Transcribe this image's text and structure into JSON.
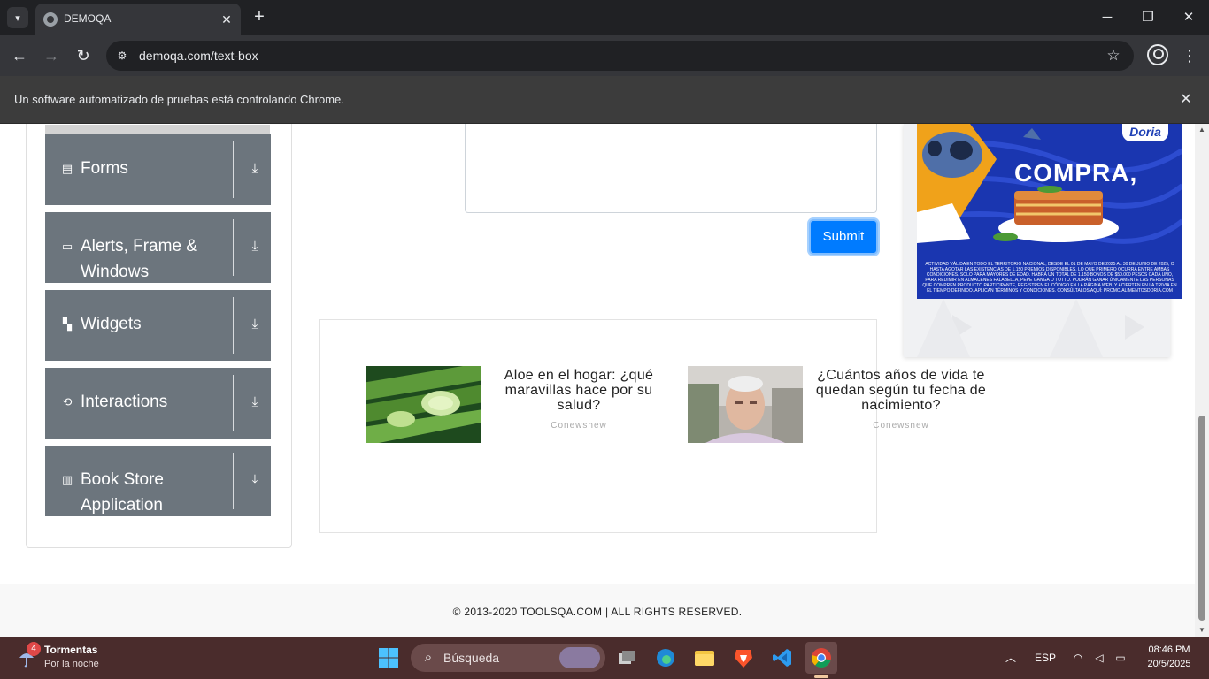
{
  "browser": {
    "tab_title": "DEMOQA",
    "url": "demoqa.com/text-box",
    "infobar_text": "Un software automatizado de pruebas está controlando Chrome."
  },
  "sidebar": {
    "groups": [
      {
        "label": "Forms",
        "icon": "document-icon"
      },
      {
        "label": "Alerts, Frame & Windows",
        "icon": "window-icon"
      },
      {
        "label": "Widgets",
        "icon": "widgets-icon"
      },
      {
        "label": "Interactions",
        "icon": "interactions-icon"
      },
      {
        "label": "Book Store Application",
        "icon": "books-icon"
      }
    ]
  },
  "form": {
    "submit_label": "Submit"
  },
  "ads": {
    "stories": [
      {
        "title": "Aloe en el hogar: ¿qué maravillas hace por su salud?",
        "source": "Conewsnew"
      },
      {
        "title": "¿Cuántos años de vida te quedan según tu fecha de nacimiento?",
        "source": "Conewsnew"
      }
    ],
    "banner": {
      "brand": "Doria",
      "headline": "COMPRA,",
      "legal": "ACTIVIDAD VÁLIDA EN TODO EL TERRITORIO NACIONAL, DESDE EL 01 DE MAYO DE 2025 AL 30 DE JUNIO DE 2025, O HASTA AGOTAR LAS EXISTENCIAS DE 1.150 PREMIOS DISPONIBLES, LO QUE PRIMERO OCURRA ENTRE AMBAS CONDICIONES. SOLO PARA MAYORES DE EDAD. HABRÁ UN TOTAL DE 1.150 BONOS DE $50.000 PESOS CADA UNO, PARA REDIMIR EN ALMACENES FALABELLA, PEPE GANGA O TOTTO. PODRÁN GANAR ÚNICAMENTE LAS PERSONAS QUE COMPREN PRODUCTO PARTICIPANTE, REGISTREN EL CÓDIGO EN LA PÁGINA WEB, Y ACIERTEN EN LA TRIVIA EN EL TIEMPO DEFINIDO. APLICAN TÉRMINOS Y CONDICIONES. CONSÚLTALOS AQUÍ: PROMO.ALIMENTOSDORIA.COM"
    }
  },
  "footer": {
    "text": "© 2013-2020 TOOLSQA.COM | ALL RIGHTS RESERVED."
  },
  "taskbar": {
    "weather_title": "Tormentas",
    "weather_sub": "Por la noche",
    "weather_badge": "4",
    "search_placeholder": "Búsqueda",
    "lang": "ESP",
    "time": "08:46 PM",
    "date": "20/5/2025"
  }
}
